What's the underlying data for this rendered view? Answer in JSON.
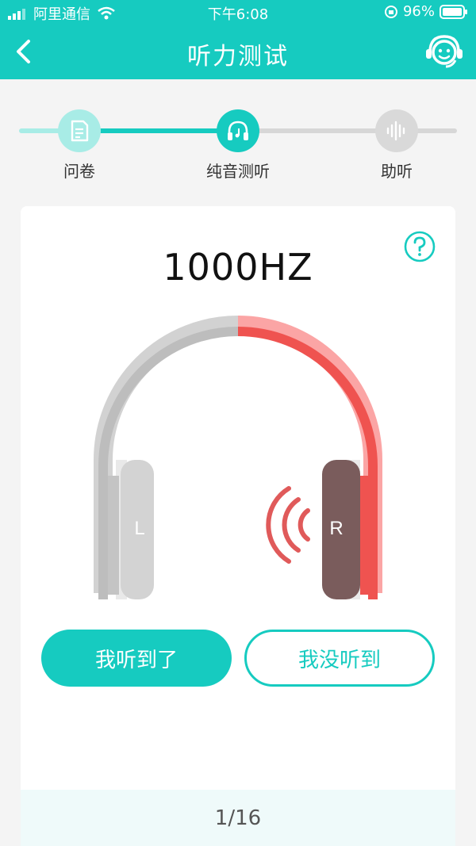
{
  "status": {
    "carrier": "阿里通信",
    "time": "下午6:08",
    "battery": "96%"
  },
  "nav": {
    "title": "听力测试",
    "back_icon": "chevron-left-icon",
    "service_icon": "customer-service-icon"
  },
  "steps": [
    {
      "label": "问卷",
      "icon": "document-icon",
      "state": "done"
    },
    {
      "label": "纯音测听",
      "icon": "headphones-icon",
      "state": "active"
    },
    {
      "label": "助听",
      "icon": "soundwave-icon",
      "state": "pending"
    }
  ],
  "test": {
    "frequency": "1000HZ",
    "left_label": "L",
    "right_label": "R",
    "active_ear": "right",
    "help_icon": "question-icon"
  },
  "actions": {
    "heard": "我听到了",
    "not_heard": "我没听到"
  },
  "progress": "1/16",
  "colors": {
    "accent": "#16cbc0",
    "active_ear": "#ef5350",
    "ear_pad_active": "#7a5c5c",
    "inactive": "#c8c8c8"
  }
}
